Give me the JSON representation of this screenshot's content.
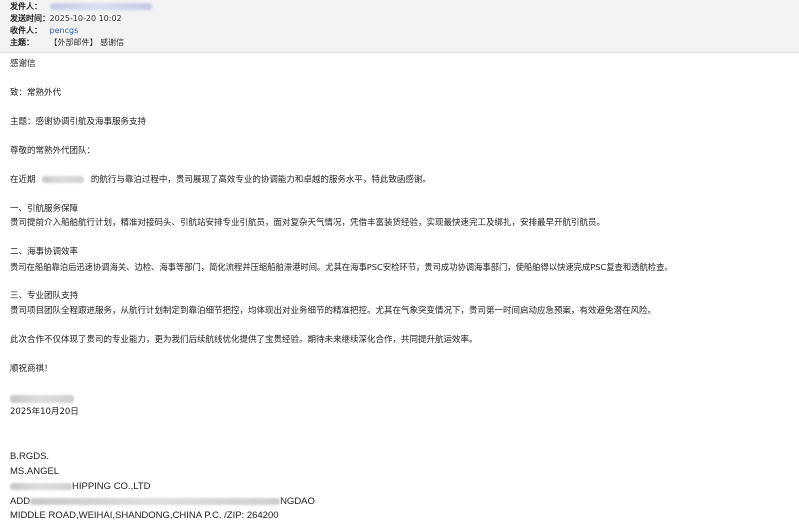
{
  "header": {
    "from_label": "发件人：",
    "sent_label": "发送时间：",
    "sent_value": "2025-10-20 10:02",
    "to_label": "收件人：",
    "to_value": "pencgs",
    "subject_label": "主题：",
    "subject_value": "【外部邮件】 感谢信"
  },
  "body": {
    "heading": "感谢信",
    "to_line": "致：常熟外代",
    "subject_line": "主题：感谢协调引航及海事服务支持",
    "greeting": "尊敬的常熟外代团队：",
    "intro_a": "在近期",
    "intro_b": "的航行与靠泊过程中，贵司展现了高效专业的协调能力和卓越的服务水平，特此致函感谢。",
    "s1_title": "一、引航服务保障",
    "s1_text": "贵司提前介入船舶航行计划，精准对接码头、引航站安排专业引航员，面对复杂天气情况，凭借丰富装货经验，实现最快速完工及绑扎，安排最早开航引航员。",
    "s2_title": "二、海事协调效率",
    "s2_text": "贵司在船舶靠泊后迅速协调海关、边检、海事等部门，简化流程并压缩船舶滞港时间。尤其在海事PSC安检环节，贵司成功协调海事部门，使船舶得以快速完成PSC复查和透航检查。",
    "s3_title": "三、专业团队支持",
    "s3_text": "贵司项目团队全程跟进服务，从航行计划制定到靠泊细节把控，均体现出对业务细节的精准把控。尤其在气象突变情况下，贵司第一时间启动应急预案，有效避免潜在风险。",
    "closing": "此次合作不仅体现了贵司的专业能力，更为我们后续航线优化提供了宝贵经验。期待未来继续深化合作，共同提升航运效率。",
    "wish": "顺祝商祺！",
    "date": "2025年10月20日"
  },
  "signature": {
    "regards": "B.RGDS.",
    "name": "MS.ANGEL",
    "company_tail": "HIPPING CO.,LTD",
    "addr_head": "ADD",
    "addr_tail": "NGDAO",
    "addr_line2": "MIDDLE ROAD,WEIHAI,SHANDONG,CHINA  P.C. /ZIP: 264200"
  }
}
